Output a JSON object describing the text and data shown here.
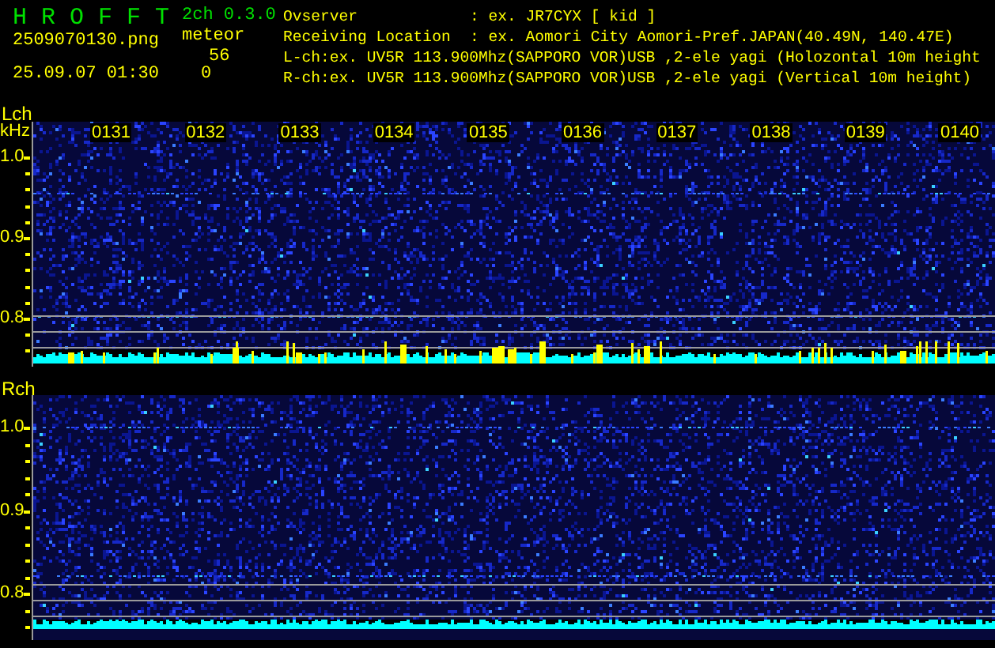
{
  "header": {
    "app_name": "H R O F F T",
    "version": "2ch 0.3.0",
    "filename": "2509070130.png",
    "datetime": "25.09.07 01:30",
    "meteor_label": "meteor",
    "counts": [
      "56",
      "0"
    ],
    "info": [
      {
        "label": "Ovserver",
        "value": ": ex. JR7CYX [ kid ]"
      },
      {
        "label": "Receiving Location",
        "value": ": ex. Aomori City Aomori-Pref.JAPAN(40.49N, 140.47E)"
      }
    ],
    "channels_info": [
      "L-ch:ex. UV5R 113.900Mhz(SAPPORO VOR)USB ,2-ele yagi (Holozontal 10m height",
      "R-ch:ex. UV5R 113.900Mhz(SAPPORO VOR)USB ,2-ele yagi (Vertical 10m height)"
    ]
  },
  "panels": [
    {
      "label": "Lch",
      "unit": "kHz",
      "axis": [
        "1.0",
        "0.9",
        "0.8"
      ],
      "time_labels": [
        "0131",
        "0132",
        "0133",
        "0134",
        "0135",
        "0136",
        "0137",
        "0138",
        "0139",
        "0140"
      ]
    },
    {
      "label": "Rch",
      "axis": [
        "1.0",
        "0.9",
        "0.8"
      ]
    }
  ]
}
